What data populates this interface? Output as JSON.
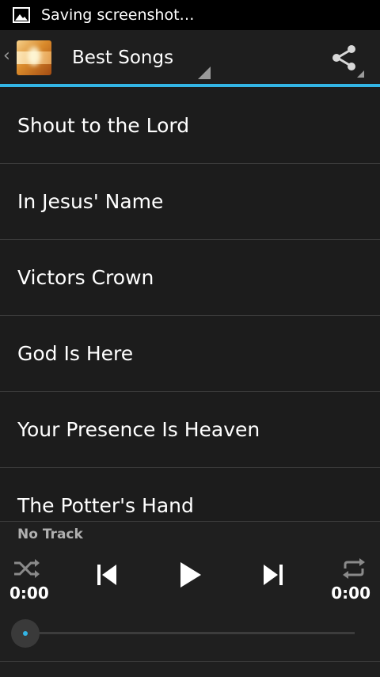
{
  "statusbar": {
    "icon": "image-icon",
    "text": "Saving screenshot…"
  },
  "actionbar": {
    "back_icon": "chevron-left-icon",
    "logo": "app-logo",
    "title": "Best Songs",
    "share_icon": "share-icon"
  },
  "songs": [
    "Shout to the Lord",
    "In Jesus' Name",
    "Victors Crown",
    "God Is Here",
    "Your Presence Is Heaven",
    "The Potter's Hand"
  ],
  "player": {
    "track_label": "No Track",
    "elapsed": "0:00",
    "duration": "0:00",
    "progress": 0,
    "icons": {
      "shuffle": "shuffle-icon",
      "previous": "skip-previous-icon",
      "play": "play-icon",
      "next": "skip-next-icon",
      "repeat": "repeat-icon"
    }
  },
  "colors": {
    "accent": "#33b5e5",
    "background": "#1c1c1c",
    "statusbar": "#000000"
  }
}
